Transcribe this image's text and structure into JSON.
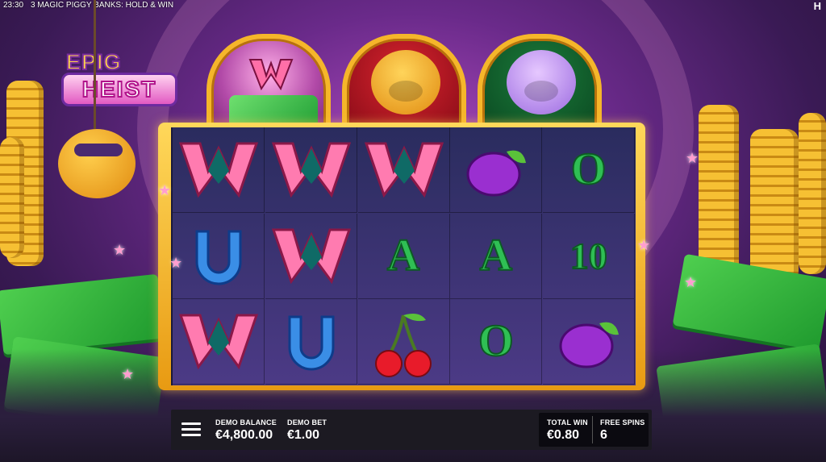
{
  "status_bar": {
    "time": "23:30",
    "game_title": "3 MAGIC PIGGY BANKS: HOLD & WIN"
  },
  "brand_mark": "H",
  "logo": {
    "line1": "EPIG",
    "line2": "HEIST"
  },
  "pots": [
    {
      "name": "cash-pot",
      "icon": "cash-stack-icon"
    },
    {
      "name": "gold-pig-pot",
      "icon": "gold-pig-icon"
    },
    {
      "name": "purple-pig-pot",
      "icon": "purple-pig-icon"
    }
  ],
  "reels": [
    [
      "wild",
      "horseshoe",
      "wild"
    ],
    [
      "wild",
      "wild",
      "horseshoe"
    ],
    [
      "wild",
      "A",
      "cherry"
    ],
    [
      "plum",
      "A",
      "O"
    ],
    [
      "O",
      "10",
      "plum"
    ]
  ],
  "hud": {
    "balance_label": "DEMO BALANCE",
    "balance_value": "€4,800.00",
    "bet_label": "DEMO BET",
    "bet_value": "€1.00",
    "total_win_label": "TOTAL WIN",
    "total_win_value": "€0.80",
    "free_spins_label": "FREE SPINS",
    "free_spins_value": "6"
  },
  "colors": {
    "frame_gold": "#f5b62a",
    "grid_bg": "#3a3470",
    "hud_bg": "#1c1a22"
  }
}
